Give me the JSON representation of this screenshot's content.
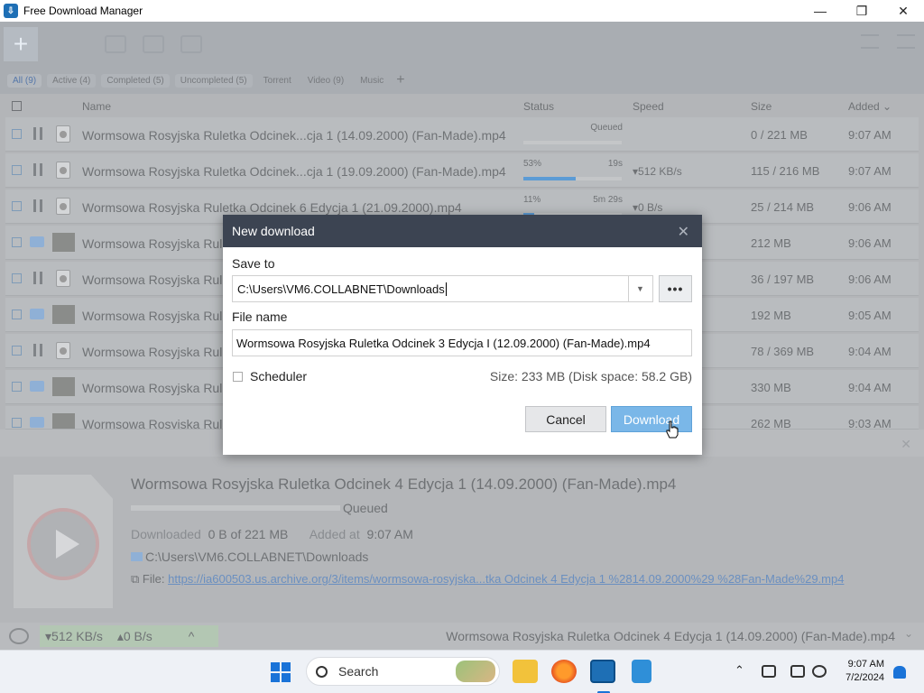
{
  "window": {
    "title": "Free Download Manager",
    "icon": "fdm-logo-icon"
  },
  "filters": [
    {
      "label": "All (9)",
      "active": true
    },
    {
      "label": "Active (4)"
    },
    {
      "label": "Completed (5)"
    },
    {
      "label": "Uncompleted (5)"
    },
    {
      "label": "Torrent"
    },
    {
      "label": "Video (9)"
    },
    {
      "label": "Music"
    }
  ],
  "columns": {
    "name": "Name",
    "status": "Status",
    "speed": "Speed",
    "size": "Size",
    "added": "Added"
  },
  "rows": [
    {
      "name": "Wormsowa Rosyjska Ruletka Odcinek...cja 1 (14.09.2000) (Fan-Made).mp4",
      "status": "Queued",
      "progress": 0,
      "speed": "",
      "size": "0 / 221 MB",
      "added": "9:07 AM",
      "state": "paused"
    },
    {
      "name": "Wormsowa Rosyjska Ruletka Odcinek...cja 1 (19.09.2000) (Fan-Made).mp4",
      "percent": "53%",
      "eta": "19s",
      "progress": 53,
      "speed": "▾512 KB/s",
      "size": "115 / 216 MB",
      "added": "9:07 AM",
      "state": "downloading"
    },
    {
      "name": "Wormsowa Rosyjska Ruletka Odcinek 6 Edycja 1 (21.09.2000).mp4",
      "percent": "11%",
      "eta": "5m 29s",
      "progress": 11,
      "speed": "▾0 B/s",
      "size": "25 / 214 MB",
      "added": "9:06 AM",
      "state": "downloading"
    },
    {
      "name": "Wormsowa Rosyjska Ruletka",
      "size": "212 MB",
      "added": "9:06 AM",
      "state": "completed"
    },
    {
      "name": "Wormsowa Rosyjska Rul",
      "size": "36 / 197 MB",
      "added": "9:06 AM",
      "state": "paused"
    },
    {
      "name": "Wormsowa Rosyjska Rul",
      "size": "192 MB",
      "added": "9:05 AM",
      "state": "completed"
    },
    {
      "name": "Wormsowa Rosyjska Rul",
      "size": "78 / 369 MB",
      "added": "9:04 AM",
      "state": "paused"
    },
    {
      "name": "Wormsowa Rosyjska Rul",
      "size": "330 MB",
      "added": "9:04 AM",
      "state": "completed"
    },
    {
      "name": "Wormsowa Rosyjska Rul",
      "size": "262 MB",
      "added": "9:03 AM",
      "state": "completed"
    }
  ],
  "details": {
    "title": "Wormsowa Rosyjska Ruletka Odcinek 4 Edycja 1 (14.09.2000) (Fan-Made).mp4",
    "state": "Queued",
    "downloaded_label": "Downloaded",
    "downloaded_value": "0 B of 221 MB",
    "added_label": "Added at",
    "added_value": "9:07 AM",
    "path": "C:\\Users\\VM6.COLLABNET\\Downloads",
    "file_label": "File:",
    "file_url": "https://ia600503.us.archive.org/3/items/wormsowa-rosyjska...tka Odcinek 4 Edycja 1 %2814.09.2000%29 %28Fan-Made%29.mp4"
  },
  "statusbar": {
    "download_speed": "▾512 KB/s",
    "upload_speed": "▴0 B/s",
    "current_file": "Wormsowa Rosyjska Ruletka Odcinek 4 Edycja 1 (14.09.2000) (Fan-Made).mp4"
  },
  "dialog": {
    "title": "New download",
    "save_to_label": "Save to",
    "save_to_value": "C:\\Users\\VM6.COLLABNET\\Downloads",
    "browse_label": "•••",
    "file_name_label": "File name",
    "file_name_value": "Wormsowa Rosyjska Ruletka Odcinek 3 Edycja I (12.09.2000) (Fan-Made).mp4",
    "scheduler_label": "Scheduler",
    "size_info": "Size: 233 MB (Disk space: 58.2 GB)",
    "cancel_label": "Cancel",
    "download_label": "Download"
  },
  "taskbar": {
    "search_placeholder": "Search",
    "time": "9:07 AM",
    "date": "7/2/2024"
  },
  "colors": {
    "accent": "#5b9bd5",
    "dialog_header": "#3c4452",
    "primary_button": "#7ab7e8"
  }
}
